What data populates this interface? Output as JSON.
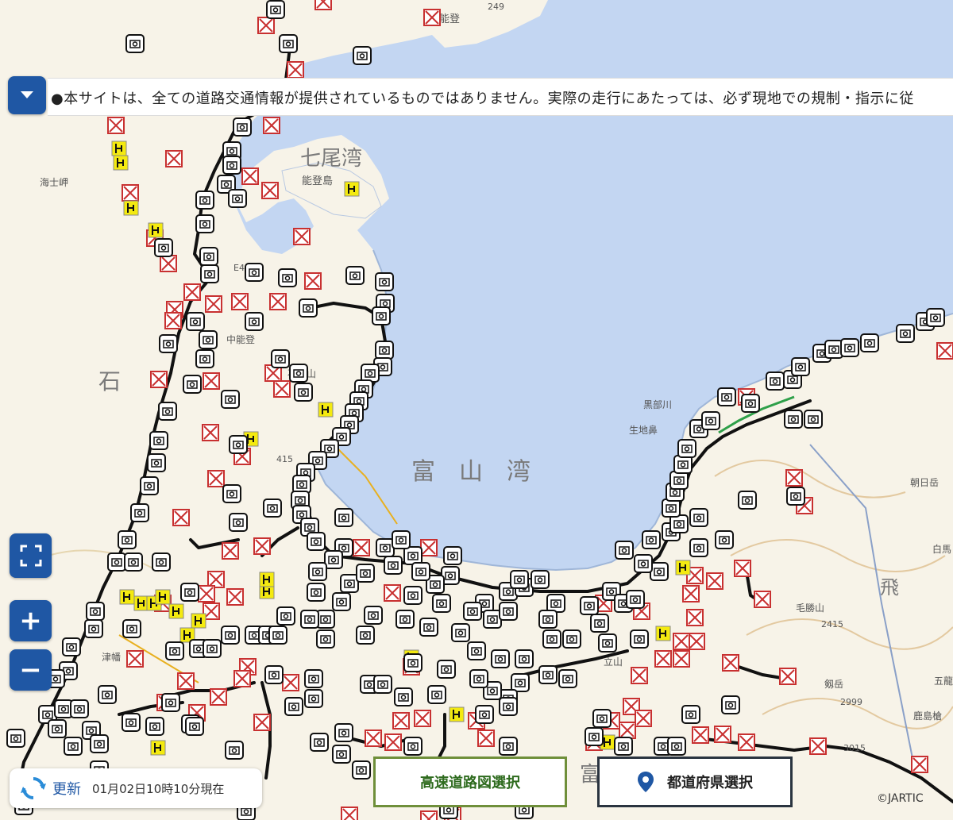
{
  "notice": {
    "text": "●本サイトは、全ての道路交通情報が提供されているものではありません。実際の走行にあたっては、必ず現地での規制・指示に従"
  },
  "map_labels": {
    "nanao_bay": "七尾湾",
    "toyama_bay": "富　山　湾",
    "ishikawa": "石",
    "noto": "能登",
    "notojima": "能登島",
    "hakui_misaki": "海士岬",
    "nakanoto": "中能登",
    "sekidosan": "石動山",
    "kurobe": "黒部川",
    "ikuji": "生地鼻",
    "asahidake": "朝日岳",
    "tsubata": "津幡",
    "tateyama": "立山",
    "kenashi": "毛勝山",
    "kenashi_elev": "2415",
    "tsurugi": "剱岳",
    "tsurugi_elev": "2999",
    "tateyama_elev": "3015",
    "kashimayari": "鹿島槍",
    "shirouma": "白馬",
    "hi": "飛",
    "goryu": "五龍",
    "route_415": "415",
    "route_249": "249",
    "e41": "E41",
    "toyama": "富"
  },
  "controls": {
    "toggle_icon": "chevron-down-icon",
    "fullscreen_icon": "fullscreen-icon",
    "zoom_in": "+",
    "zoom_out": "−"
  },
  "update": {
    "label": "更新",
    "time": "01月02日10時10分現在"
  },
  "buttons": {
    "highway": "高速道路図選択",
    "prefecture": "都道府県選択"
  },
  "attribution": "©JARTIC",
  "colors": {
    "sea": "#c3d6f2",
    "land": "#f7f3e8",
    "road": "#111111",
    "closure": "#d03030",
    "chain": "#f0e000",
    "accent": "#1f57a4"
  }
}
